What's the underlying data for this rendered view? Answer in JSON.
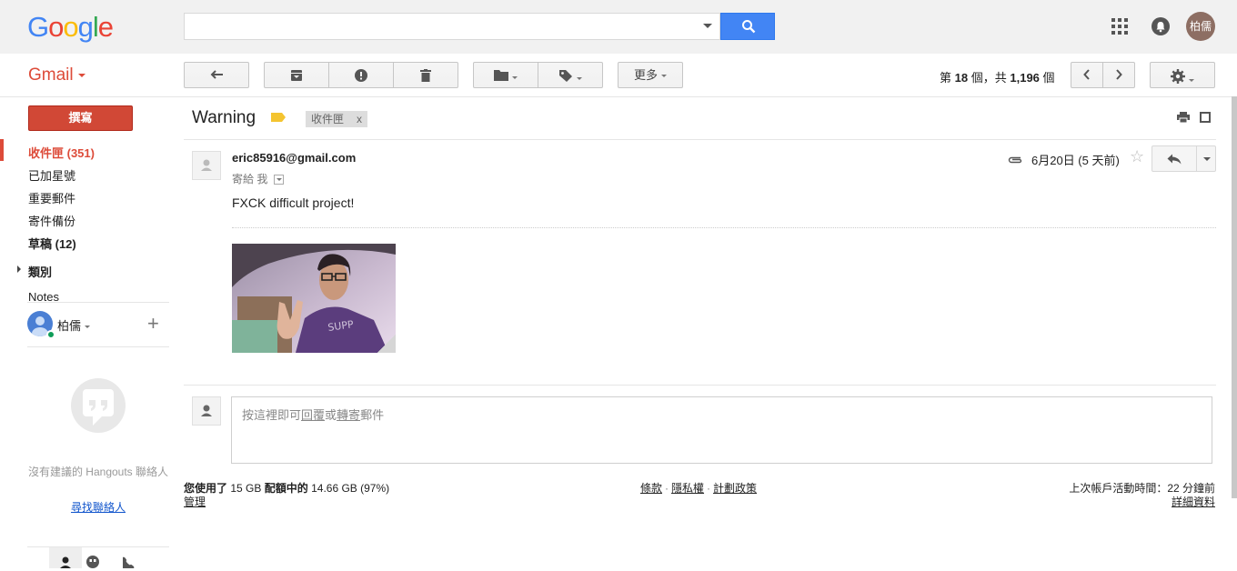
{
  "logo": {
    "letters": [
      "G",
      "o",
      "o",
      "g",
      "l",
      "e"
    ],
    "colors": [
      "#4285f4",
      "#ea4335",
      "#fbbc05",
      "#4285f4",
      "#34a853",
      "#ea4335"
    ]
  },
  "search": {
    "value": "",
    "placeholder": ""
  },
  "header": {
    "account_initials": "柏儒"
  },
  "toolbar": {
    "app_label": "Gmail",
    "more_label": "更多",
    "pager": {
      "prefix": "第",
      "position": "18",
      "mid": "個，共",
      "total": "1,196",
      "suffix": "個"
    }
  },
  "sidebar": {
    "compose_label": "撰寫",
    "items": [
      {
        "label": "收件匣 (351)"
      },
      {
        "label": "已加星號"
      },
      {
        "label": "重要郵件"
      },
      {
        "label": "寄件備份"
      },
      {
        "label": "草稿 (12)"
      },
      {
        "label": "類別"
      },
      {
        "label": "Notes"
      }
    ],
    "hangouts": {
      "user_name": "柏儒",
      "empty_text": "沒有建議的 Hangouts 聯絡人",
      "find_link": "尋找聯絡人"
    }
  },
  "thread": {
    "subject": "Warning",
    "label_chip": "收件匣",
    "label_chip_close": "x"
  },
  "message": {
    "sender": "eric85916@gmail.com",
    "recipient_prefix": "寄給",
    "recipient": "我",
    "date": "6月20日 (5 天前)",
    "body": "FXCK difficult project!"
  },
  "reply_box": {
    "prefix": "按這裡即可",
    "reply_link": "回覆",
    "or": "或",
    "forward_link": "轉寄",
    "suffix": "郵件"
  },
  "footer": {
    "storage_prefix": "您使用了",
    "storage_used": "15 GB",
    "storage_mid": "配額中的",
    "storage_amount": "14.66 GB (97%)",
    "manage": "管理",
    "terms": "條款",
    "privacy": "隱私權",
    "program_policy": "計劃政策",
    "last_activity": "上次帳戶活動時間：22 分鐘前",
    "details": "詳細資料"
  },
  "colors": {
    "accent_red": "#dd4b39",
    "search_blue": "#4285f4",
    "compose_red": "#d14836",
    "important_yellow": "#f4c430"
  }
}
